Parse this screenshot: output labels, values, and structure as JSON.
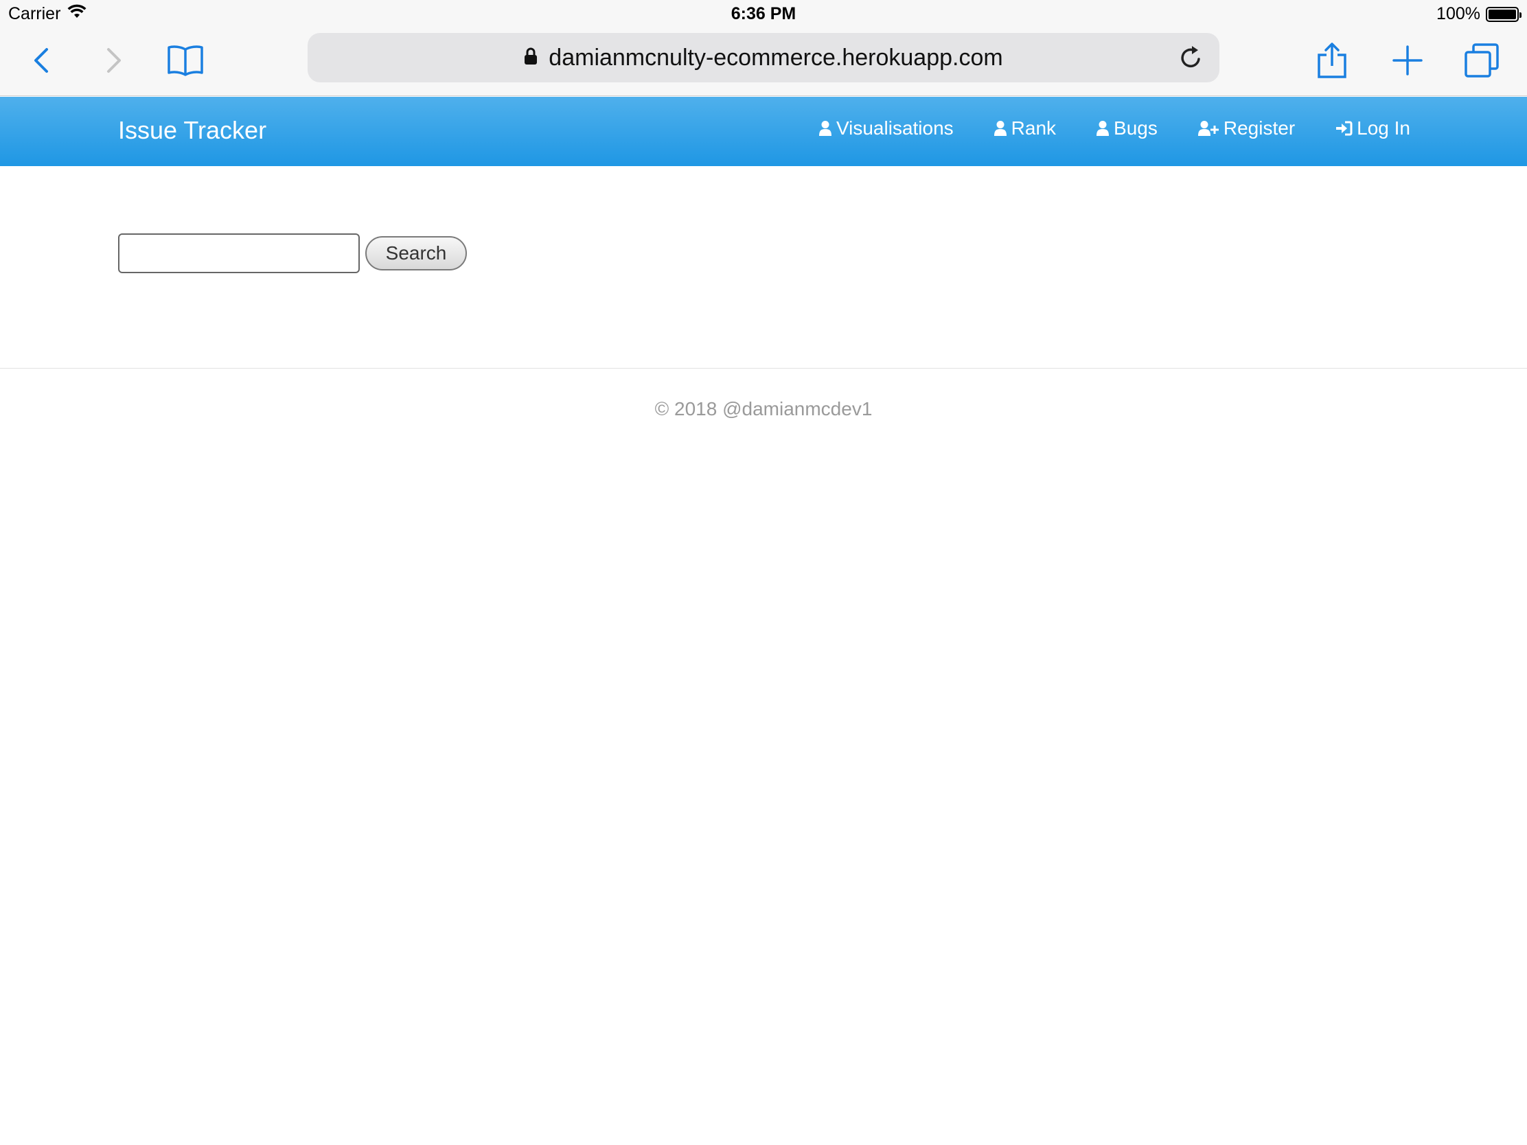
{
  "status_bar": {
    "carrier": "Carrier",
    "time": "6:36 PM",
    "battery_text": "100%",
    "battery_level": 1.0
  },
  "browser": {
    "url": "damianmcnulty-ecommerce.herokuapp.com",
    "icons": [
      "back-icon",
      "forward-icon",
      "bookmarks-icon",
      "lock-icon",
      "reload-icon",
      "share-icon",
      "new-tab-icon",
      "tabs-icon"
    ],
    "accent_color": "#1a7fe0"
  },
  "navbar": {
    "brand": "Issue Tracker",
    "items": [
      {
        "label": "Visualisations",
        "icon": "user-icon"
      },
      {
        "label": "Rank",
        "icon": "user-icon"
      },
      {
        "label": "Bugs",
        "icon": "user-icon"
      },
      {
        "label": "Register",
        "icon": "user-plus-icon"
      },
      {
        "label": "Log In",
        "icon": "sign-in-icon"
      }
    ],
    "colors": {
      "gradient_top": "#4fb0ec",
      "gradient_bottom": "#1f97e4"
    }
  },
  "search": {
    "value": "",
    "placeholder": "",
    "button_label": "Search"
  },
  "footer": {
    "text": "© 2018 @damianmcdev1"
  }
}
